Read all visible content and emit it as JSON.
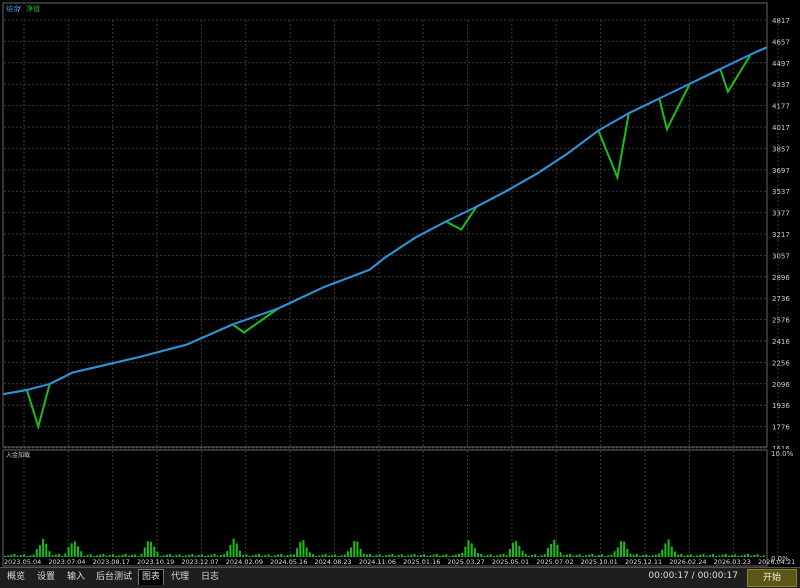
{
  "main_chart": {
    "legend": {
      "balance_label": "结余",
      "separator": " / ",
      "equity_label": "净值"
    },
    "y_ticks": [
      4817,
      4657,
      4497,
      4337,
      4177,
      4017,
      3857,
      3697,
      3537,
      3377,
      3217,
      3057,
      2896,
      2736,
      2576,
      2416,
      2256,
      2096,
      1936,
      1776,
      1616
    ],
    "x_ticks": [
      "2023.05.04",
      "2023.07.04",
      "2023.08.17",
      "2023.10.19",
      "2023.12.07",
      "2024.02.09",
      "2024.05.16",
      "2024.08.23",
      "2024.11.06",
      "2025.01.16",
      "2025.03.27",
      "2025.05.01",
      "2025.07.02",
      "2025.10.01",
      "2025.12.11",
      "2026.02.24",
      "2026.03.23",
      "2026.04.21"
    ]
  },
  "sub_chart": {
    "label": "入金加载",
    "y_ticks": [
      "10.0%",
      "0.0%"
    ]
  },
  "chart_data": {
    "type": "line",
    "title": "",
    "ylim": [
      1616,
      4817
    ],
    "x_index_range": [
      0,
      1
    ],
    "series": [
      {
        "name": "结余",
        "color": "#2f8fe0",
        "x": [
          0,
          0.03,
          0.06,
          0.09,
          0.12,
          0.18,
          0.24,
          0.3,
          0.36,
          0.42,
          0.48,
          0.5,
          0.54,
          0.58,
          0.62,
          0.66,
          0.7,
          0.74,
          0.78,
          0.82,
          0.86,
          0.9,
          0.94,
          0.98,
          1.0
        ],
        "values": [
          2020,
          2050,
          2095,
          2180,
          2220,
          2300,
          2390,
          2540,
          2660,
          2820,
          2950,
          3040,
          3190,
          3310,
          3420,
          3540,
          3670,
          3820,
          3990,
          4120,
          4230,
          4340,
          4450,
          4560,
          4610
        ]
      },
      {
        "name": "净值",
        "color": "#17c017",
        "x": [
          0,
          0.03,
          0.045,
          0.06,
          0.09,
          0.12,
          0.18,
          0.24,
          0.3,
          0.315,
          0.36,
          0.42,
          0.48,
          0.5,
          0.54,
          0.58,
          0.6,
          0.62,
          0.66,
          0.7,
          0.74,
          0.78,
          0.805,
          0.82,
          0.86,
          0.87,
          0.9,
          0.94,
          0.95,
          0.98,
          1.0
        ],
        "values": [
          2020,
          2050,
          1776,
          2095,
          2180,
          2220,
          2300,
          2390,
          2540,
          2480,
          2660,
          2820,
          2950,
          3040,
          3190,
          3310,
          3250,
          3420,
          3540,
          3670,
          3820,
          3990,
          3640,
          4120,
          4230,
          4000,
          4340,
          4450,
          4280,
          4560,
          4610
        ]
      }
    ]
  },
  "tabs": [
    "概览",
    "设置",
    "输入",
    "后台测试",
    "图表",
    "代理",
    "日志"
  ],
  "active_tab_index": 4,
  "status": {
    "time_text": "00:00:17 / 00:00:17"
  },
  "start_button": "开始",
  "colors": {
    "balance": "#2f8fe0",
    "equity": "#17c017",
    "grid": "#3a3a3a",
    "background": "#000000"
  }
}
